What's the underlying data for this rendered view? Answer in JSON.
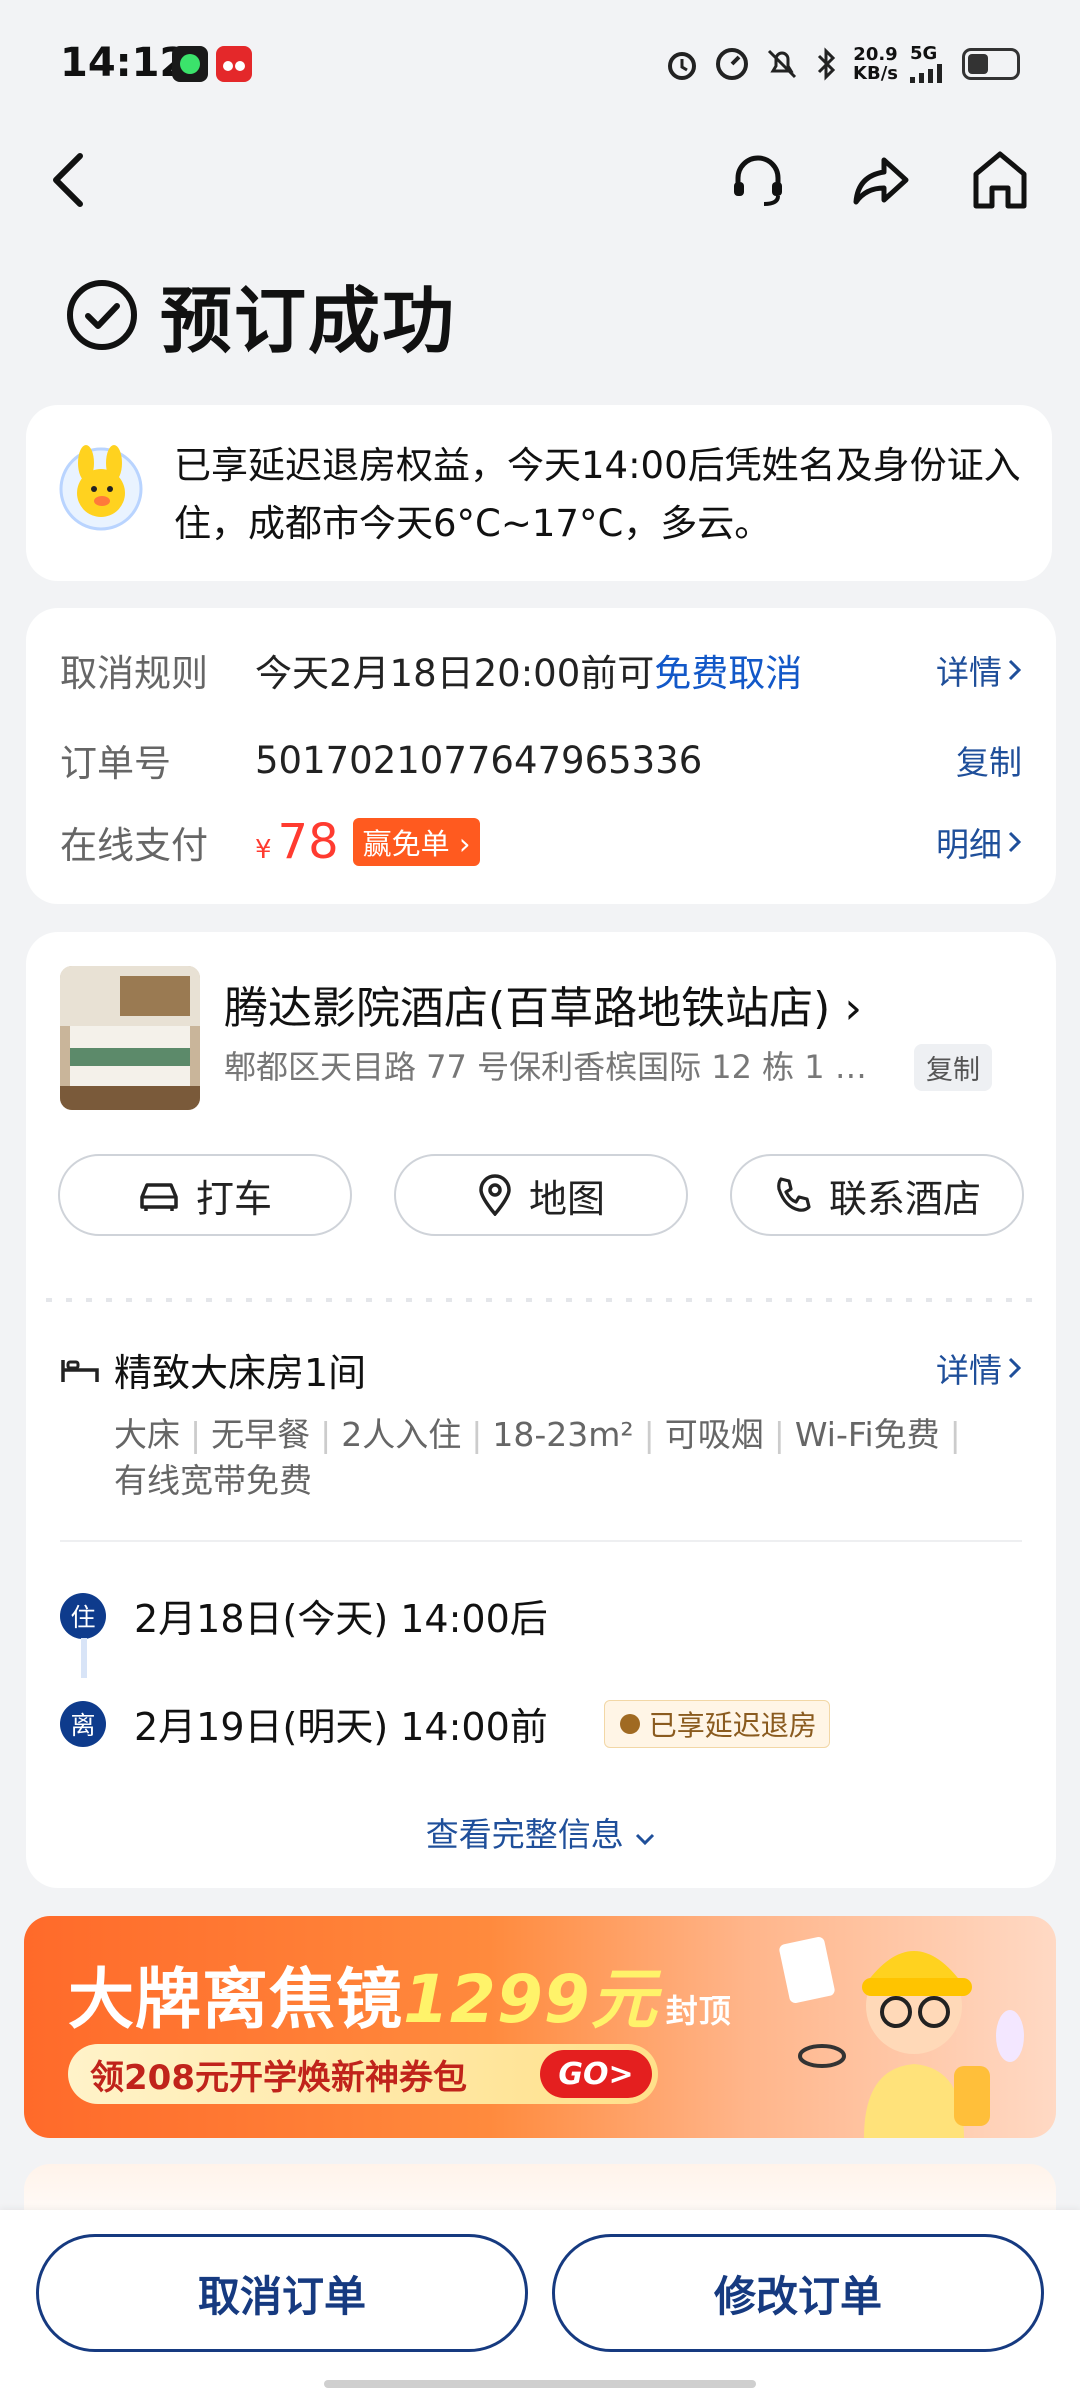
{
  "status": {
    "time": "14:12",
    "speed": "20.9",
    "speed_unit": "KB/s",
    "network": "5G"
  },
  "success_title": "预订成功",
  "notice": {
    "text": "已享延迟退房权益，今天14:00后凭姓名及身份证入住，成都市今天6°C~17°C，多云。"
  },
  "order": {
    "cancel_label": "取消规则",
    "cancel_prefix": "今天2月18日20:00前可",
    "cancel_free": "免费取消",
    "cancel_action": "详情",
    "order_no_label": "订单号",
    "order_no": "5017021077647965336",
    "copy_action": "复制",
    "pay_label": "在线支付",
    "currency": "¥",
    "price": "78",
    "win_tag": "赢免单",
    "pay_action": "明细"
  },
  "hotel": {
    "name": "腾达影院酒店(百草路地铁站店)",
    "address": "郫都区天目路 77 号保利香槟国际 12 栋 1 …",
    "copy": "复制",
    "taxi": "打车",
    "map": "地图",
    "contact": "联系酒店",
    "room_title": "精致大床房1间",
    "room_detail": "详情",
    "tags": [
      "大床",
      "无早餐",
      "2人入住",
      "18-23m²",
      "可吸烟",
      "Wi-Fi免费",
      "有线宽带免费"
    ],
    "checkin_badge": "住",
    "checkin": "2月18日(今天) 14:00后",
    "checkout_badge": "离",
    "checkout": "2月19日(明天) 14:00前",
    "late_tag": "已享延迟退房",
    "view_more": "查看完整信息"
  },
  "banner": {
    "title_a": "大牌离焦镜",
    "title_b": "1299元",
    "title_c": "封顶",
    "subtitle": "领208元开学焕新神券包",
    "go": "GO>"
  },
  "bottom": {
    "cancel": "取消订单",
    "modify": "修改订单"
  },
  "colors": {
    "brand_blue": "#163a80",
    "link_blue": "#1258c8",
    "price_red": "#ff3b30",
    "banner_orange": "#ff6a2a"
  }
}
